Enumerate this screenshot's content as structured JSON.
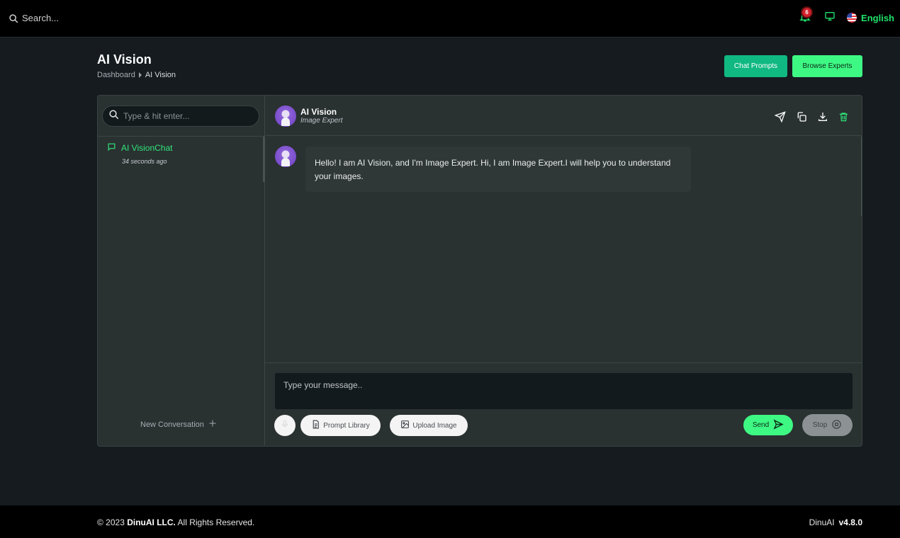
{
  "topbar": {
    "search_placeholder": "Search...",
    "notification_count": "6",
    "language": "English"
  },
  "header": {
    "title": "AI Vision",
    "breadcrumb": [
      "Dashboard",
      "AI Vision"
    ],
    "chat_prompts_label": "Chat Prompts",
    "browse_experts_label": "Browse Experts"
  },
  "sidebar": {
    "search_placeholder": "Type & hit enter...",
    "conversations": [
      {
        "title": "AI VisionChat",
        "time": "34 seconds ago"
      }
    ],
    "new_conversation_label": "New Conversation"
  },
  "chat": {
    "expert_name": "AI Vision",
    "expert_role": "Image Expert",
    "messages": [
      {
        "sender": "AI Vision",
        "text": "Hello! I am AI Vision, and I'm Image Expert. Hi, I am Image Expert.I will help you to understand your images."
      }
    ],
    "input_placeholder": "Type your message..",
    "prompt_library_label": "Prompt Library",
    "upload_image_label": "Upload Image",
    "send_label": "Send",
    "stop_label": "Stop"
  },
  "footer": {
    "copyright_prefix": "© 2023 ",
    "company": "DinuAI LLC.",
    "copyright_suffix": " All Rights Reserved.",
    "app_name": "DinuAI",
    "version": "v4.8.0"
  },
  "colors": {
    "accent_green": "#3ef884",
    "brand_teal": "#10b981",
    "link_green": "#1fe26a",
    "badge_red": "#d0202a"
  },
  "icons": [
    "search-icon",
    "bell-icon",
    "monitor-icon",
    "flag-icon",
    "chat-bubble-icon",
    "plus-icon",
    "send-icon",
    "copy-icon",
    "download-icon",
    "trash-icon",
    "microphone-icon",
    "document-icon",
    "image-icon",
    "stop-icon"
  ]
}
